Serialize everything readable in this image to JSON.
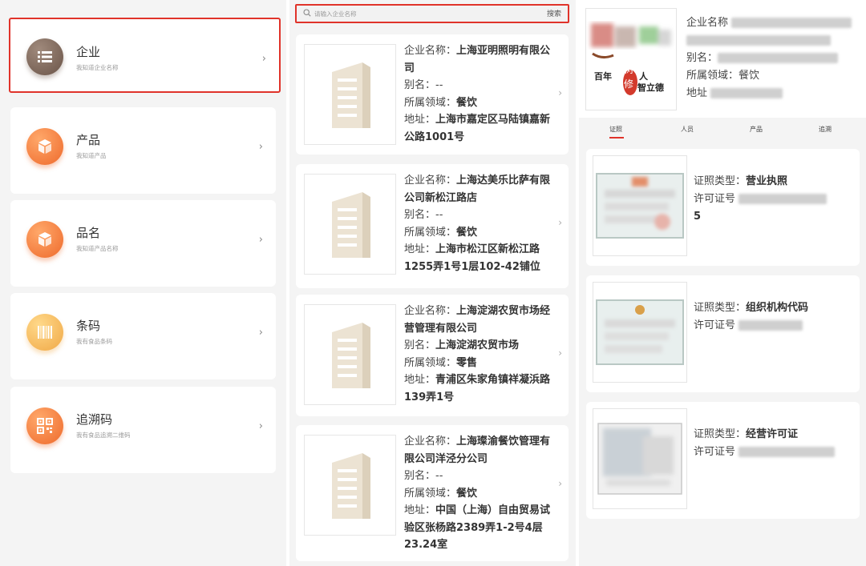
{
  "categories": [
    {
      "title": "企业",
      "sub": "我知道企业名称"
    },
    {
      "title": "产品",
      "sub": "我知道产品"
    },
    {
      "title": "品名",
      "sub": "我知道产品名称"
    },
    {
      "title": "条码",
      "sub": "我有食品条码"
    },
    {
      "title": "追溯码",
      "sub": "我有食品追溯二维码"
    }
  ],
  "chevron": "›",
  "search": {
    "placeholder": "请输入企业名称",
    "button": "搜索"
  },
  "labels": {
    "name": "企业名称：",
    "alias": "别名：",
    "field": "所属领域：",
    "address": "地址："
  },
  "results": [
    {
      "name": "上海亚明照明有限公司",
      "alias": "--",
      "field": "餐饮",
      "address": "上海市嘉定区马陆镇嘉新公路1001号"
    },
    {
      "name": "上海达美乐比萨有限公司新松江路店",
      "alias": "--",
      "field": "餐饮",
      "address": "上海市松江区新松江路1255弄1号1层102-42铺位"
    },
    {
      "name": "上海淀湖农贸市场经营管理有限公司",
      "alias": "上海淀湖农贸市场",
      "field": "零售",
      "address": "青浦区朱家角镇祥凝浜路139弄1号"
    },
    {
      "name": "上海璨渝餐饮管理有限公司洋泾分公司",
      "alias": "--",
      "field": "餐饮",
      "address": "中国（上海）自由贸易试验区张杨路2389弄1-2号4层23.24室"
    }
  ],
  "detail": {
    "labels": {
      "name": "企业名称",
      "alias": "别名：",
      "field": "所属领域：",
      "address": "地址"
    },
    "field": "餐饮",
    "logo_text": "百年树人 修智立德",
    "tabs": [
      "证照",
      "人员",
      "产品",
      "追溯"
    ],
    "cert_labels": {
      "type": "证照类型：",
      "number": "许可证号"
    },
    "certs": [
      {
        "type": "营业执照",
        "number_tail": "5"
      },
      {
        "type": "组织机构代码",
        "number_tail": ""
      },
      {
        "type": "经营许可证",
        "number_tail": ""
      }
    ]
  }
}
